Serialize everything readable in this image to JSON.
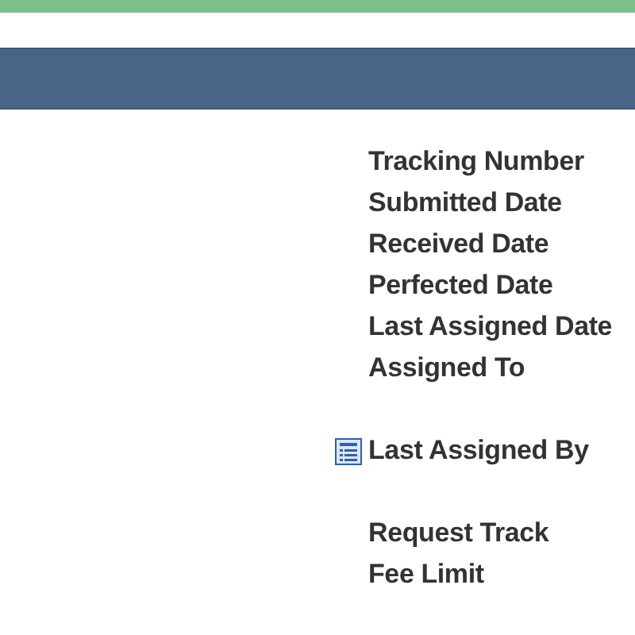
{
  "field_groups": [
    {
      "fields": [
        {
          "label": "Tracking Number",
          "icon": false
        },
        {
          "label": "Submitted Date",
          "icon": false
        },
        {
          "label": "Received Date",
          "icon": false
        },
        {
          "label": "Perfected Date",
          "icon": false
        },
        {
          "label": "Last Assigned Date",
          "icon": false
        },
        {
          "label": "Assigned To",
          "icon": false
        }
      ]
    },
    {
      "fields": [
        {
          "label": "Last Assigned By",
          "icon": true
        }
      ]
    },
    {
      "fields": [
        {
          "label": "Request Track",
          "icon": false
        },
        {
          "label": "Fee Limit",
          "icon": false
        }
      ]
    }
  ]
}
